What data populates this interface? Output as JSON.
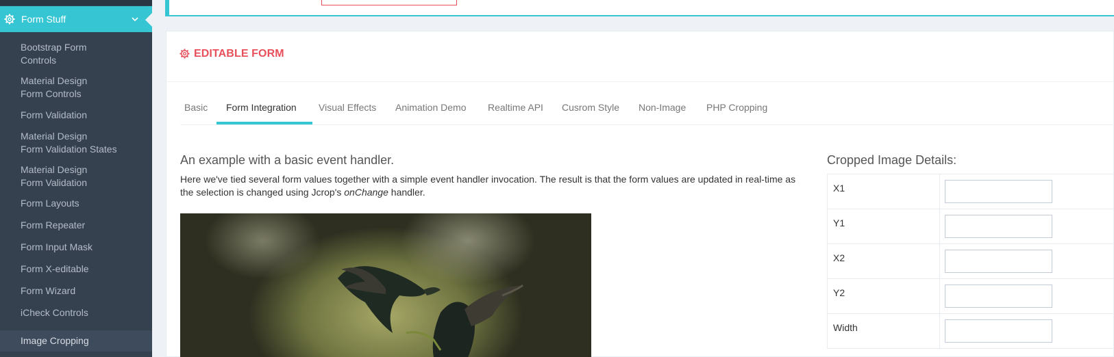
{
  "sidebar": {
    "active_menu": {
      "label": "Form Stuff",
      "icon": "gear-icon"
    },
    "items": [
      {
        "line1": "Bootstrap Form",
        "line2": "Controls"
      },
      {
        "line1": "Material Design",
        "line2": "Form Controls"
      },
      {
        "line1": "Form Validation",
        "line2": ""
      },
      {
        "line1": "Material Design",
        "line2": "Form Validation States"
      },
      {
        "line1": "Material Design",
        "line2": "Form Validation"
      },
      {
        "line1": "Form Layouts",
        "line2": ""
      },
      {
        "line1": "Form Repeater",
        "line2": ""
      },
      {
        "line1": "Form Input Mask",
        "line2": ""
      },
      {
        "line1": "Form X-editable",
        "line2": ""
      },
      {
        "line1": "Form Wizard",
        "line2": ""
      },
      {
        "line1": "iCheck Controls",
        "line2": ""
      },
      {
        "line1": "Image Cropping",
        "line2": ""
      }
    ]
  },
  "portlet": {
    "title": "EDITABLE FORM",
    "title_color": "#e7505a"
  },
  "tabs": [
    {
      "label": "Basic"
    },
    {
      "label": "Form Integration"
    },
    {
      "label": "Visual Effects"
    },
    {
      "label": "Animation Demo"
    },
    {
      "label": "Realtime API"
    },
    {
      "label": "Cusrom Style"
    },
    {
      "label": "Non-Image"
    },
    {
      "label": "PHP Cropping"
    }
  ],
  "active_tab": "Form Integration",
  "example": {
    "heading": "An example with a basic event handler.",
    "text_before": "Here we've tied several form values together with a simple event handler invocation. The result is that the form values are updated in real-time as the selection is changed using Jcrop's ",
    "text_em": "onChange",
    "text_after": " handler."
  },
  "details": {
    "heading": "Cropped Image Details:",
    "fields": [
      {
        "label": "X1",
        "value": ""
      },
      {
        "label": "Y1",
        "value": ""
      },
      {
        "label": "X2",
        "value": ""
      },
      {
        "label": "Y2",
        "value": ""
      },
      {
        "label": "Width",
        "value": ""
      }
    ]
  },
  "colors": {
    "accent": "#36c6d3",
    "sidebar_bg": "#364150"
  }
}
